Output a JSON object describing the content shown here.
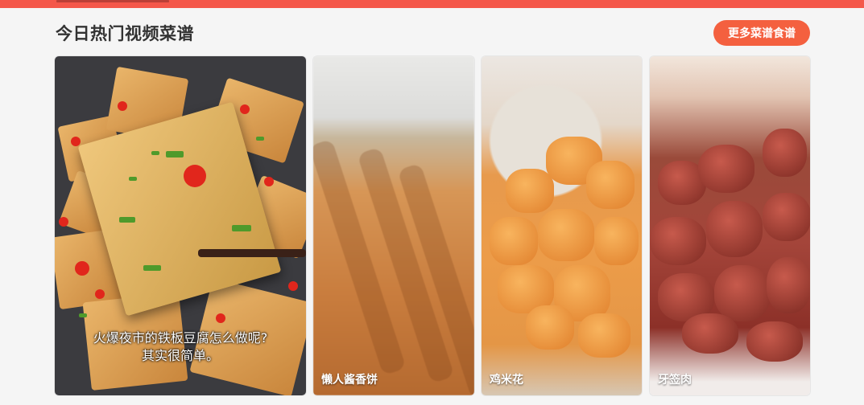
{
  "header": {
    "title": "今日热门视频菜谱",
    "more_button": "更多菜谱食谱"
  },
  "cards": [
    {
      "subtitle_line1": "火爆夜市的铁板豆腐怎么做呢?",
      "subtitle_line2": "其实很简单。",
      "caption": ""
    },
    {
      "caption": "懒人酱香饼"
    },
    {
      "caption": "鸡米花"
    },
    {
      "caption": "牙签肉"
    }
  ],
  "colors": {
    "accent": "#f4574a",
    "button": "#f4603f",
    "title": "#333333",
    "background": "#f5f5f5"
  }
}
